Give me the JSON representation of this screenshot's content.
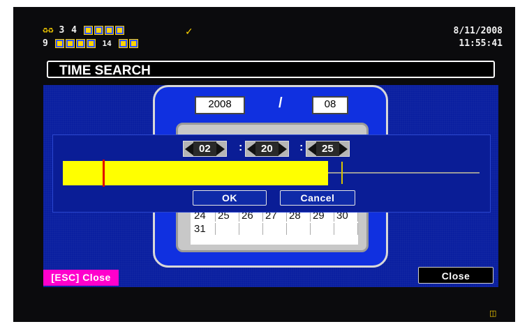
{
  "status": {
    "row1": {
      "icons": [
        "person-icon",
        "person-icon"
      ],
      "numbers": [
        "3",
        "4"
      ],
      "boxes": 4
    },
    "row2": {
      "n1": "9",
      "n2": "14"
    },
    "alarm_icon": "speaker-mute-icon"
  },
  "datetime": {
    "date": "8/11/2008",
    "time": "11:55:41"
  },
  "title": "TIME SEARCH",
  "calendar": {
    "year": "2008",
    "separator": "/",
    "month": "08",
    "rows": [
      [
        "24",
        "25",
        "26",
        "27",
        "28",
        "29",
        "30"
      ],
      [
        "31",
        "",
        "",
        "",
        "",
        "",
        ""
      ]
    ]
  },
  "time_picker": {
    "hour": "02",
    "minute": "20",
    "second": "25",
    "sep": ":"
  },
  "timeline": {
    "fill_fraction": 0.64,
    "current_marker_fraction": 0.1,
    "end_marker_fraction": 0.67,
    "fill_color": "#ffff00",
    "marker_color": "#e00000"
  },
  "buttons": {
    "ok": "OK",
    "cancel": "Cancel",
    "close": "Close",
    "esc_close": "[ESC] Close"
  },
  "bottom_icon": "network-icon",
  "colors": {
    "panel": "#0a1fa0",
    "esc": "#ff00cc",
    "accent": "#ffd400"
  }
}
